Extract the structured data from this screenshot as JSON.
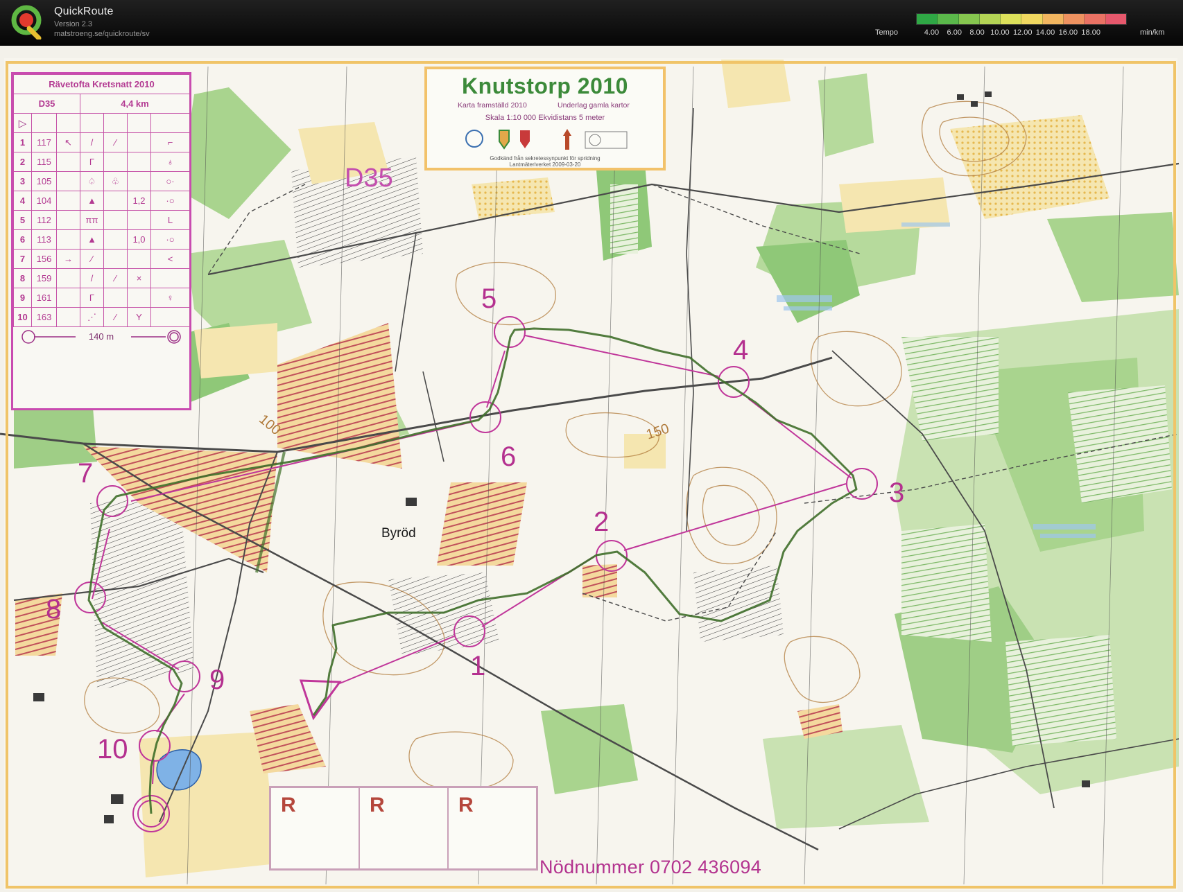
{
  "app": {
    "name": "QuickRoute",
    "version": "Version 2.3",
    "url": "matstroeng.se/quickroute/sv",
    "icon": "quickroute-logo-icon"
  },
  "legend": {
    "label": "Tempo",
    "ticks": [
      "4.00",
      "6.00",
      "8.00",
      "10.00",
      "12.00",
      "14.00",
      "16.00",
      "18.00"
    ],
    "unit": "min/km",
    "colors": [
      "#2fa845",
      "#5ab84a",
      "#86c64f",
      "#b4d455",
      "#dce05a",
      "#f0d860",
      "#f2b660",
      "#ee9260",
      "#ea7264",
      "#e6586c"
    ]
  },
  "map": {
    "title": "Knutstorp 2010",
    "made": "Karta framställd 2010",
    "base": "Underlag gamla kartor",
    "scale": "Skala 1:10 000   Ekvidistans 5 meter",
    "approval": "Godkänd från sekretessynpunkt för spridning",
    "lantmateriet": "Lantmäteriverket 2009-03-20",
    "class_label": "D35",
    "place": "Byröd",
    "contour_150": "150",
    "contour_100": "100",
    "emergency": "Nödnummer 0702 436094",
    "r_boxes": [
      "R",
      "R",
      "R"
    ],
    "control_numbers": [
      "1",
      "2",
      "3",
      "4",
      "5",
      "6",
      "7",
      "8",
      "9",
      "10"
    ],
    "colors": {
      "course": "#c0369a",
      "route": "#3f6f2a",
      "green_dark": "#6fae55",
      "green_light": "#cfe6b8",
      "yellow": "#f3dc9a",
      "brown": "#b07a3a"
    }
  },
  "controls": {
    "event": "Rävetofta Kretsnatt 2010",
    "class": "D35",
    "length": "4,4 km",
    "rows": [
      {
        "num": "1",
        "code": "117",
        "c1": "↖",
        "c2": "/",
        "c3": "⁄",
        "c4": "",
        "c5": "⌐"
      },
      {
        "num": "2",
        "code": "115",
        "c1": "",
        "c2": "Γ",
        "c3": "",
        "c4": "",
        "c5": "♁"
      },
      {
        "num": "3",
        "code": "105",
        "c1": "",
        "c2": "♤",
        "c3": "♧",
        "c4": "",
        "c5": "○·"
      },
      {
        "num": "4",
        "code": "104",
        "c1": "",
        "c2": "▲",
        "c3": "",
        "c4": "1,2",
        "c5": "·○"
      },
      {
        "num": "5",
        "code": "112",
        "c1": "",
        "c2": "ππ",
        "c3": "",
        "c4": "",
        "c5": "L"
      },
      {
        "num": "6",
        "code": "113",
        "c1": "",
        "c2": "▲",
        "c3": "",
        "c4": "1,0",
        "c5": "·○"
      },
      {
        "num": "7",
        "code": "156",
        "c1": "→",
        "c2": "⁄",
        "c3": "",
        "c4": "",
        "c5": "<"
      },
      {
        "num": "8",
        "code": "159",
        "c1": "",
        "c2": "/",
        "c3": "⁄",
        "c4": "×",
        "c5": ""
      },
      {
        "num": "9",
        "code": "161",
        "c1": "",
        "c2": "Γ",
        "c3": "",
        "c4": "",
        "c5": "♀"
      },
      {
        "num": "10",
        "code": "163",
        "c1": "",
        "c2": "⋰",
        "c3": "⁄",
        "c4": "Y",
        "c5": ""
      }
    ],
    "finish_distance": "140 m"
  }
}
